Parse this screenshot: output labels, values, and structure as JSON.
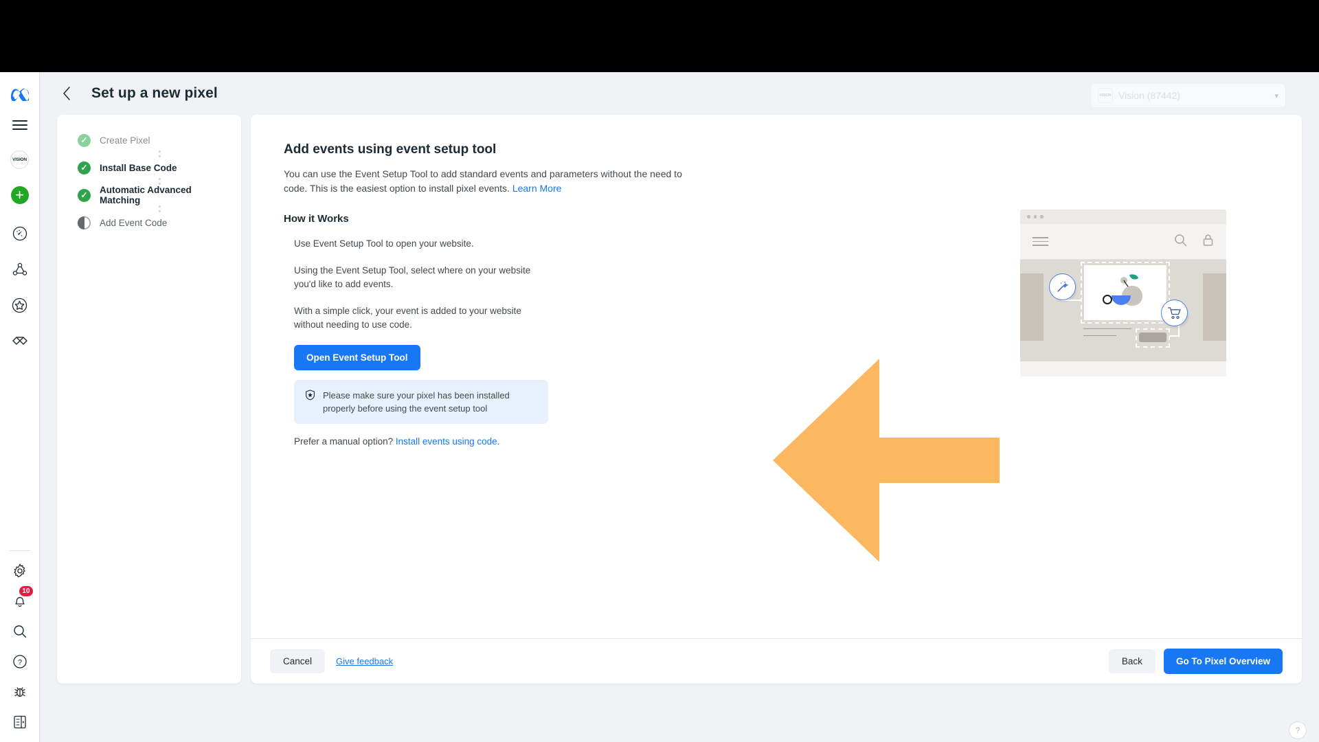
{
  "window": {
    "title_bar_color": "#000000"
  },
  "rail": {
    "items": [
      {
        "name": "meta-logo-icon",
        "label": "Meta"
      },
      {
        "name": "menu-icon",
        "label": "Menu"
      },
      {
        "name": "account-avatar",
        "label": "VISION"
      },
      {
        "name": "create-icon",
        "label": "Create"
      },
      {
        "name": "performance-icon",
        "label": "Performance"
      },
      {
        "name": "audiences-icon",
        "label": "Audiences"
      },
      {
        "name": "favorites-icon",
        "label": "Favorites"
      },
      {
        "name": "partnerships-icon",
        "label": "Partnerships"
      }
    ],
    "bottom_items": [
      {
        "name": "settings-icon",
        "label": "Settings"
      },
      {
        "name": "notifications-icon",
        "label": "Notifications",
        "badge": "10"
      },
      {
        "name": "search-icon",
        "label": "Search"
      },
      {
        "name": "help-icon",
        "label": "Help"
      },
      {
        "name": "bug-report-icon",
        "label": "Report a bug"
      },
      {
        "name": "toggle-panel-icon",
        "label": "Toggle panel"
      }
    ]
  },
  "header": {
    "title": "Set up a new pixel",
    "back_label": "Back"
  },
  "account_picker": {
    "logo_text": "VISION",
    "value": "Vision  (87442)",
    "caret": "▾"
  },
  "steps": [
    {
      "label": "Create Pixel",
      "state": "done-faded"
    },
    {
      "label": "Install Base Code",
      "state": "done"
    },
    {
      "label": "Automatic Advanced Matching",
      "state": "done"
    },
    {
      "label": "Add Event Code",
      "state": "current"
    }
  ],
  "main": {
    "title": "Add events using event setup tool",
    "description_part1": "You can use the Event Setup Tool to add standard events and parameters without the need to code. This is the easiest option to install pixel events. ",
    "learn_more": "Learn More",
    "how_it_works_title": "How it Works",
    "how_items": [
      "Use Event Setup Tool to open your website.",
      "Using the Event Setup Tool, select where on your website you'd like to add events.",
      "With a simple click, your event is added to your website without needing to use code."
    ],
    "open_tool_button": "Open Event Setup Tool",
    "info_icon": "shield-icon",
    "info_text": "Please make sure your pixel has been installed properly before using the event setup tool",
    "manual_prefix": "Prefer a manual option? ",
    "manual_link": "Install events using code."
  },
  "illustration": {
    "name": "event-setup-tool-illustration",
    "browser_icons": [
      "menu-icon",
      "search-icon",
      "lock-icon"
    ],
    "badges": [
      "magic-wand-icon",
      "shopping-cart-icon"
    ]
  },
  "annotation": {
    "arrow_color": "#fbb860",
    "points_to": "Open Event Setup Tool"
  },
  "footer": {
    "cancel": "Cancel",
    "give_feedback": "Give feedback",
    "back": "Back",
    "primary": "Go To Pixel Overview"
  },
  "colors": {
    "primary_blue": "#1877f2",
    "green": "#31a24c",
    "info_bg": "#e7f0fd",
    "page_bg": "#f0f2f5",
    "arrow_orange": "#fbb860"
  }
}
